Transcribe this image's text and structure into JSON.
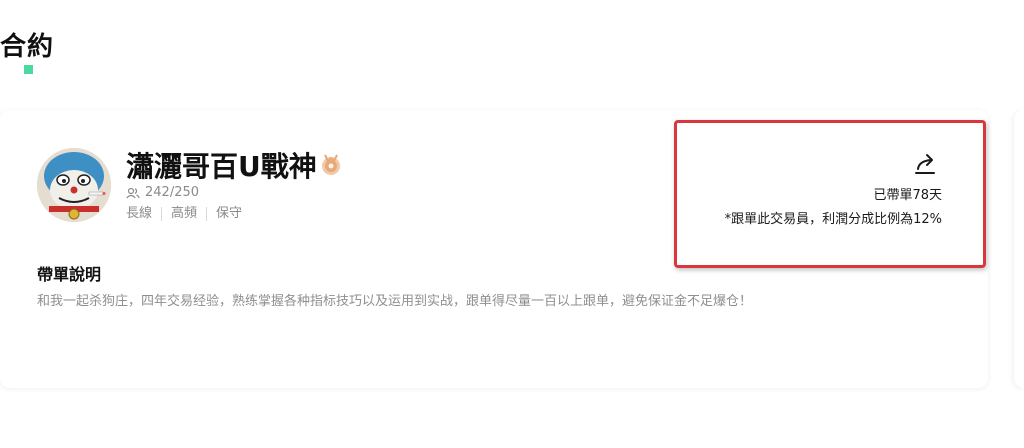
{
  "section": {
    "title": "合約"
  },
  "trader": {
    "name": "瀟灑哥百U戰神",
    "followers": "242/250",
    "tags": [
      "長線",
      "高頻",
      "保守"
    ],
    "medal_icon": "medal-icon",
    "share_icon": "share-icon"
  },
  "stats": {
    "days_led": "已帶單78天",
    "profit_share": "*跟單此交易員，利潤分成比例為12%"
  },
  "description": {
    "title": "帶單說明",
    "text": "和我一起杀狗庄，四年交易经验，熟练掌握各种指标技巧以及运用到实战，跟单得尽量一百以上跟单，避免保证金不足爆仓！"
  },
  "colors": {
    "accent": "#4cd9a0",
    "highlight": "#d9363e",
    "muted_text": "#8a8a8a"
  }
}
